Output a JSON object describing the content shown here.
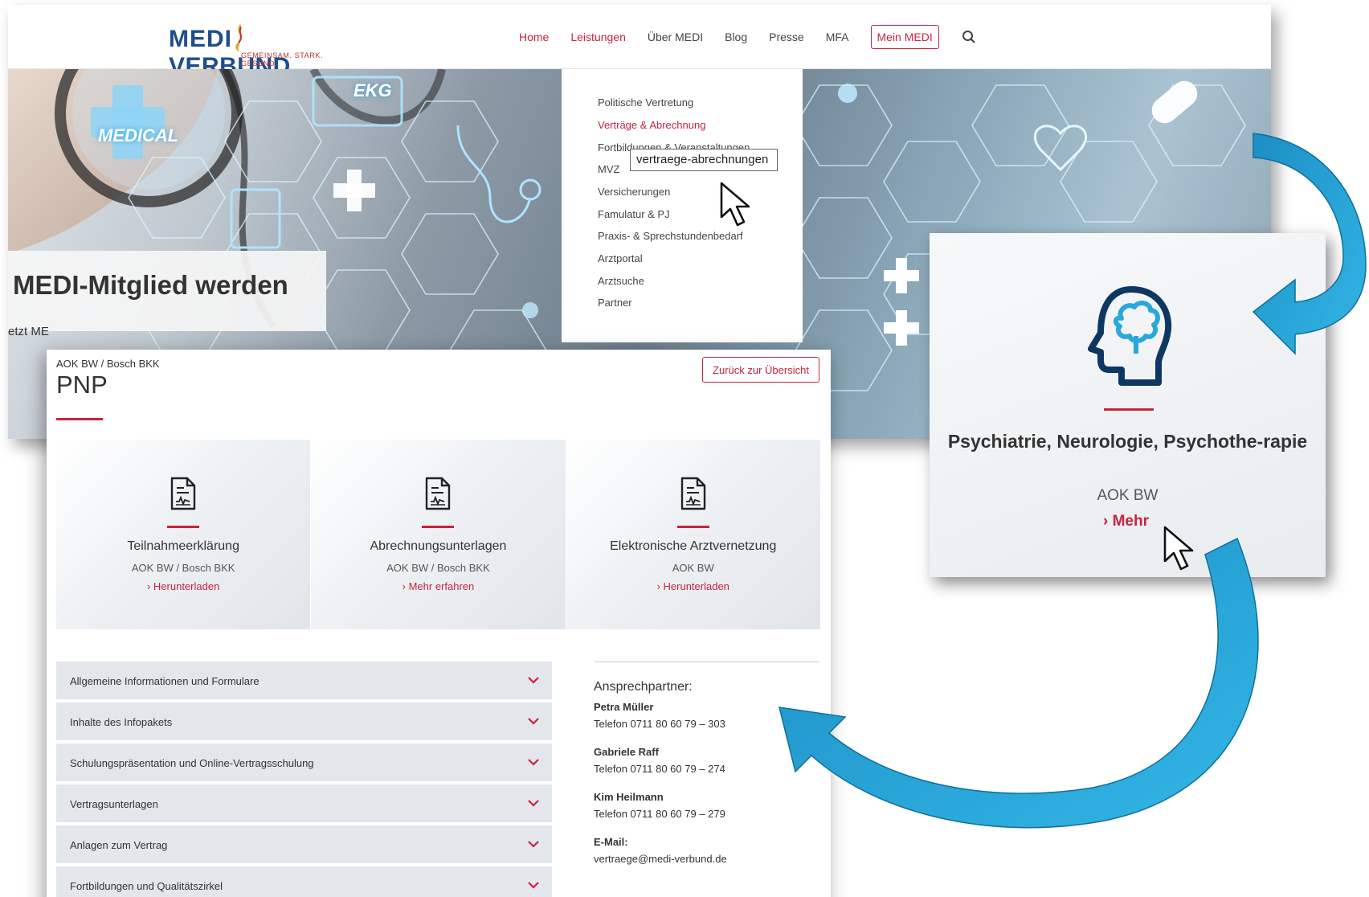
{
  "site": {
    "logo_main": "MEDI VERBUND",
    "logo_tagline": "GEMEINSAM. STARK. GESUND.",
    "nav": [
      {
        "label": "Home",
        "active": true
      },
      {
        "label": "Leistungen",
        "active": true
      },
      {
        "label": "Über MEDI",
        "active": false
      },
      {
        "label": "Blog",
        "active": false
      },
      {
        "label": "Presse",
        "active": false
      },
      {
        "label": "MFA",
        "active": false
      }
    ],
    "nav_button": "Mein MEDI",
    "search_icon": "search-icon",
    "accent_color": "#c8233f"
  },
  "hero": {
    "labels": [
      "MEDICAL",
      "EKG"
    ],
    "member_title": "MEDI-Mitglied werden",
    "member_sub": "etzt ME"
  },
  "dropdown": {
    "items": [
      "Politische Vertretung",
      "Verträge & Abrechnung",
      "Fortbildungen & Veranstaltungen",
      "MVZ",
      "Versicherungen",
      "Famulatur & PJ",
      "Praxis- & Sprechstundenbedarf",
      "Arztportal",
      "Arztsuche",
      "Partner"
    ],
    "active_index": 1,
    "tooltip": "vertraege-abrechnungen"
  },
  "detail": {
    "breadcrumb": "AOK BW / Bosch BKK",
    "title": "PNP",
    "back_button": "Zurück zur Übersicht",
    "tiles": [
      {
        "title": "Teilnahmeerklärung",
        "sub": "AOK BW / Bosch BKK",
        "link": "Herunterladen"
      },
      {
        "title": "Abrechnungsunterlagen",
        "sub": "AOK BW / Bosch BKK",
        "link": "Mehr erfahren"
      },
      {
        "title": "Elektronische Arztvernetzung",
        "sub": "AOK BW",
        "link": "Herunterladen"
      }
    ],
    "accordion": [
      "Allgemeine Informationen und Formulare",
      "Inhalte des Infopakets",
      "Schulungspräsentation und Online-Vertragsschulung",
      "Vertragsunterlagen",
      "Anlagen zum Vertrag",
      "Fortbildungen und Qualitätszirkel"
    ],
    "contact": {
      "heading": "Ansprechpartner:",
      "people": [
        {
          "name": "Petra Müller",
          "phone": "Telefon 0711 80 60 79 – 303"
        },
        {
          "name": "Gabriele Raff",
          "phone": "Telefon 0711 80 60 79 – 274"
        },
        {
          "name": "Kim Heilmann",
          "phone": "Telefon 0711 80 60 79 – 279"
        }
      ],
      "email_label": "E-Mail:",
      "email": "vertraege@medi-verbund.de"
    }
  },
  "card": {
    "icon": "brain-head-icon",
    "title": "Psychiatrie, Neurologie, Psychothe-rapie",
    "sub": "AOK BW",
    "link": "Mehr"
  },
  "colors": {
    "red": "#c8233f",
    "navy": "#1f4e8c",
    "arrow_blue": "#29a8dc"
  }
}
